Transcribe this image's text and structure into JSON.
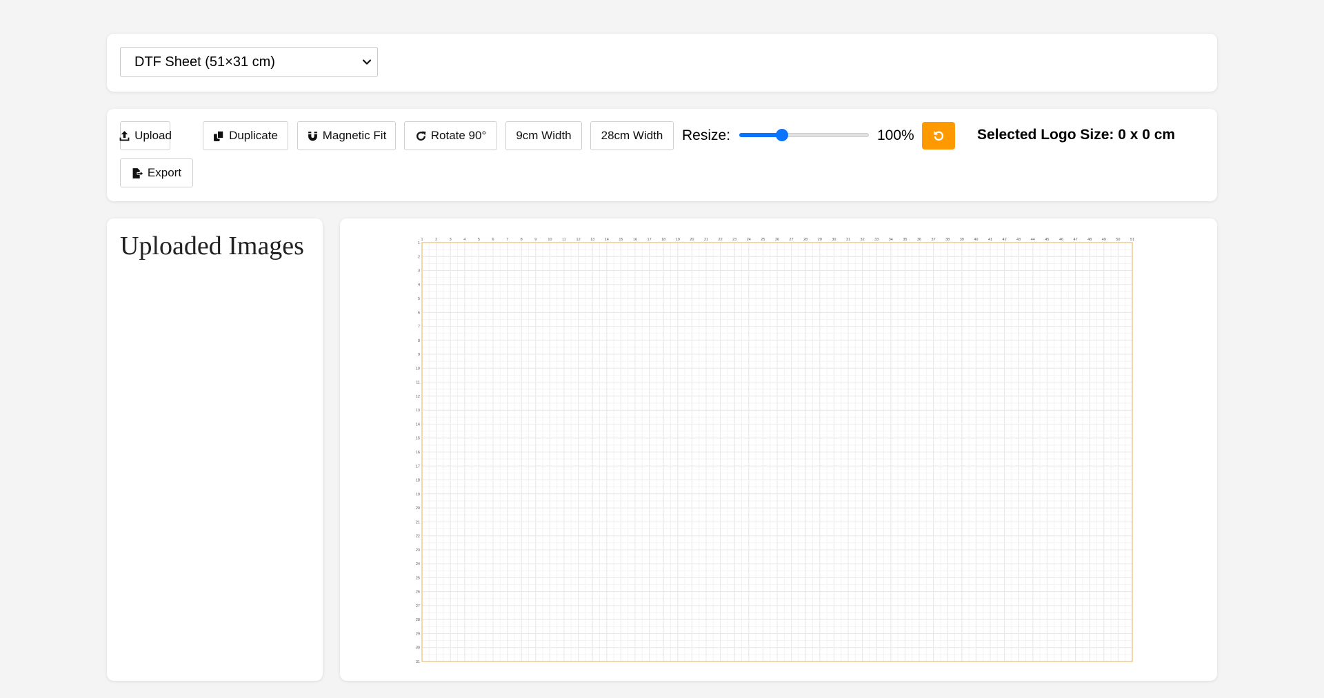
{
  "sheet_select": {
    "selected": "DTF Sheet (51×31 cm)"
  },
  "toolbar": {
    "upload_label": "Upload",
    "duplicate_label": "Duplicate",
    "magnetic_fit_label": "Magnetic Fit",
    "rotate_label": "Rotate 90°",
    "width_9_label": "9cm Width",
    "width_28_label": "28cm Width",
    "export_label": "Export",
    "resize_label": "Resize:",
    "resize_percent": "100%",
    "resize_slider_fraction": 0.33,
    "selected_logo_size": "Selected Logo Size: 0 x 0 cm",
    "reset_color": "#ff9900",
    "accent_color": "#0a74ff"
  },
  "images_panel": {
    "title": "Uploaded Images"
  },
  "sheet_grid": {
    "columns_cm": 51,
    "rows_cm": 31,
    "x_tick_labels": [
      "1",
      "2",
      "3",
      "4",
      "5",
      "6",
      "7",
      "8",
      "9",
      "10",
      "11",
      "12",
      "13",
      "14",
      "15",
      "16",
      "17",
      "18",
      "19",
      "20",
      "21",
      "22",
      "23",
      "24",
      "25",
      "26",
      "27",
      "28",
      "29",
      "30",
      "31",
      "32",
      "33",
      "34",
      "35",
      "36",
      "37",
      "38",
      "39",
      "40",
      "41",
      "42",
      "43",
      "44",
      "45",
      "46",
      "47",
      "48",
      "49",
      "50",
      "51"
    ],
    "y_tick_labels": [
      "1",
      "2",
      "3",
      "4",
      "5",
      "6",
      "7",
      "8",
      "9",
      "10",
      "11",
      "12",
      "13",
      "14",
      "15",
      "16",
      "17",
      "18",
      "19",
      "20",
      "21",
      "22",
      "23",
      "24",
      "25",
      "26",
      "27",
      "28",
      "29",
      "30",
      "31"
    ],
    "border_color": "#f0c98e",
    "grid_color": "#e8e8e8"
  }
}
